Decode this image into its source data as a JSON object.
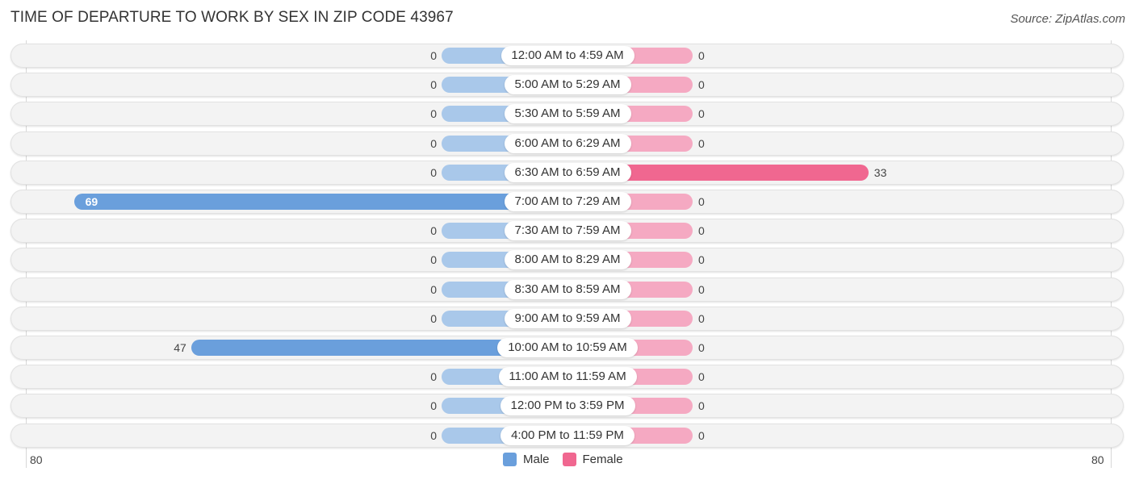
{
  "title": "TIME OF DEPARTURE TO WORK BY SEX IN ZIP CODE 43967",
  "source": "Source: ZipAtlas.com",
  "colors": {
    "male_light": "#a9c8ea",
    "male": "#6a9fdc",
    "female_light": "#f5a9c2",
    "female": "#f06790"
  },
  "chart_data": {
    "type": "bar",
    "orientation": "horizontal-diverging",
    "title": "TIME OF DEPARTURE TO WORK BY SEX IN ZIP CODE 43967",
    "categories": [
      "12:00 AM to 4:59 AM",
      "5:00 AM to 5:29 AM",
      "5:30 AM to 5:59 AM",
      "6:00 AM to 6:29 AM",
      "6:30 AM to 6:59 AM",
      "7:00 AM to 7:29 AM",
      "7:30 AM to 7:59 AM",
      "8:00 AM to 8:29 AM",
      "8:30 AM to 8:59 AM",
      "9:00 AM to 9:59 AM",
      "10:00 AM to 10:59 AM",
      "11:00 AM to 11:59 AM",
      "12:00 PM to 3:59 PM",
      "4:00 PM to 11:59 PM"
    ],
    "series": [
      {
        "name": "Male",
        "values": [
          0,
          0,
          0,
          0,
          0,
          69,
          0,
          0,
          0,
          0,
          47,
          0,
          0,
          0
        ]
      },
      {
        "name": "Female",
        "values": [
          0,
          0,
          0,
          0,
          33,
          0,
          0,
          0,
          0,
          0,
          0,
          0,
          0,
          0
        ]
      }
    ],
    "axis": {
      "left_label": "80",
      "right_label": "80",
      "range": [
        -80,
        80
      ]
    },
    "legend": {
      "position": "bottom-center",
      "entries": [
        "Male",
        "Female"
      ]
    }
  }
}
